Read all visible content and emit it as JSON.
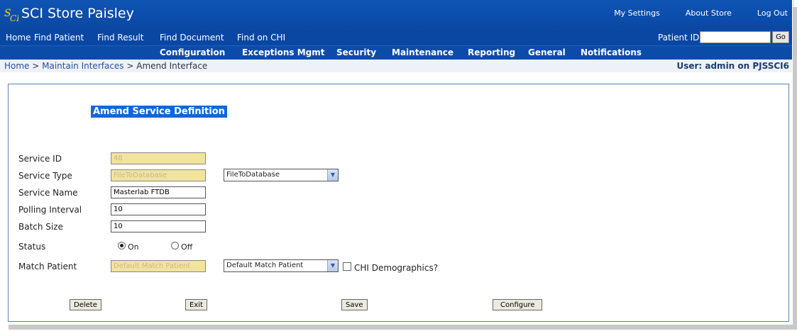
{
  "app": {
    "title": "SCI Store Paisley"
  },
  "top_links": [
    "My Settings",
    "About Store",
    "Log Out"
  ],
  "nav": {
    "items": [
      "Home",
      "Find Patient",
      "Find Result",
      "Find Document",
      "Find on CHI"
    ],
    "patient_id_label": "Patient ID:",
    "patient_id_value": "",
    "go_label": "Go"
  },
  "menu": [
    "Configuration",
    "Exceptions Mgmt",
    "Security",
    "Maintenance",
    "Reporting",
    "General",
    "Notifications"
  ],
  "breadcrumb": {
    "home": "Home",
    "sep": " > ",
    "parent": "Maintain Interfaces",
    "current": "Amend Interface"
  },
  "user": "User: admin on PJSSCI6",
  "form": {
    "title": "Amend Service Definition",
    "service_id": {
      "label": "Service ID",
      "value": "48"
    },
    "service_type": {
      "label": "Service Type",
      "value": "FileToDatabase",
      "selected": "FileToDatabase"
    },
    "service_name": {
      "label": "Service Name",
      "value": "Masterlab FTDB"
    },
    "polling_interval": {
      "label": "Polling Interval",
      "value": "10"
    },
    "batch_size": {
      "label": "Batch Size",
      "value": "10"
    },
    "status": {
      "label": "Status",
      "on_label": "On",
      "off_label": "Off",
      "selected": "On"
    },
    "match_patient": {
      "label": "Match Patient",
      "value": "Default Match Patient",
      "selected": "Default Match Patient",
      "chi_label": "CHI Demographics?",
      "chi_checked": false
    }
  },
  "buttons": {
    "delete": "Delete",
    "exit": "Exit",
    "save": "Save",
    "configure": "Configure"
  },
  "colors": {
    "header": "#0a47a3",
    "readonly_field": "#f2e39d",
    "section_title_bg": "#1266d8"
  }
}
